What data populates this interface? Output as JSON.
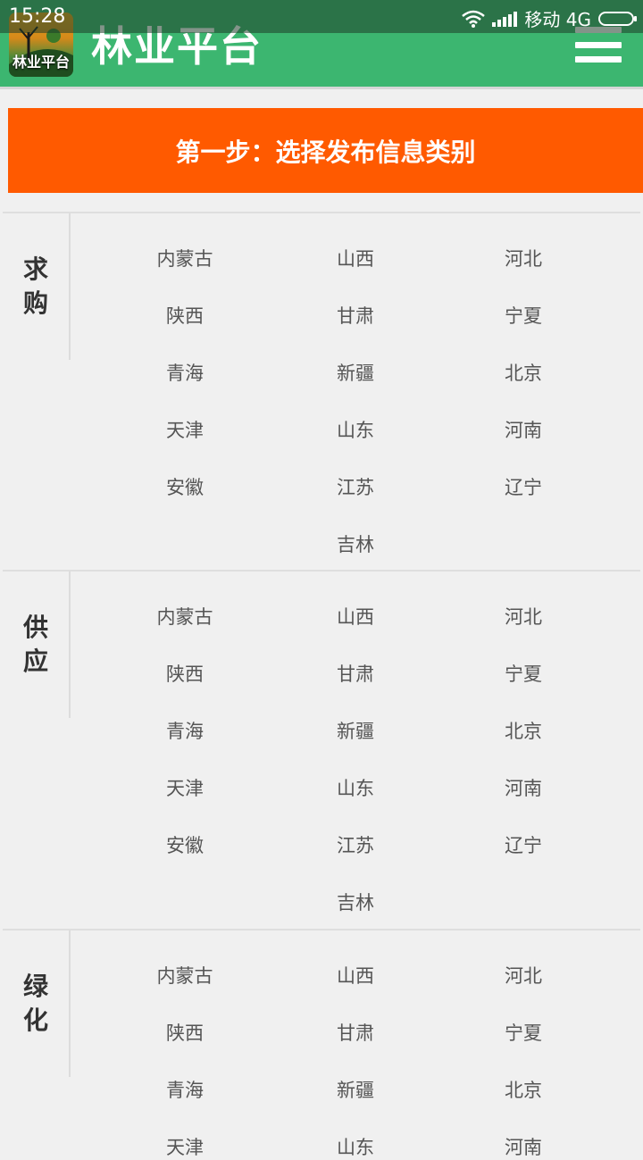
{
  "status_bar": {
    "time": "15:28",
    "carrier": "移动 4G"
  },
  "header": {
    "logo_text": "林业平台",
    "title": "林业平台",
    "menu_icon": "hamburger-icon"
  },
  "step_banner": "第一步：选择发布信息类别",
  "sections": [
    {
      "chars": [
        "求",
        "购"
      ],
      "regions": [
        "内蒙古",
        "山西",
        "河北",
        "陕西",
        "甘肃",
        "宁夏",
        "青海",
        "新疆",
        "北京",
        "天津",
        "山东",
        "河南",
        "安徽",
        "江苏",
        "辽宁",
        "吉林"
      ]
    },
    {
      "chars": [
        "供",
        "应"
      ],
      "regions": [
        "内蒙古",
        "山西",
        "河北",
        "陕西",
        "甘肃",
        "宁夏",
        "青海",
        "新疆",
        "北京",
        "天津",
        "山东",
        "河南",
        "安徽",
        "江苏",
        "辽宁",
        "吉林"
      ]
    },
    {
      "chars": [
        "绿",
        "化"
      ],
      "regions": [
        "内蒙古",
        "山西",
        "河北",
        "陕西",
        "甘肃",
        "宁夏",
        "青海",
        "新疆",
        "北京",
        "天津",
        "山东",
        "河南"
      ]
    }
  ],
  "colors": {
    "header_green": "#3cb670",
    "banner_orange": "#ff5a00"
  }
}
